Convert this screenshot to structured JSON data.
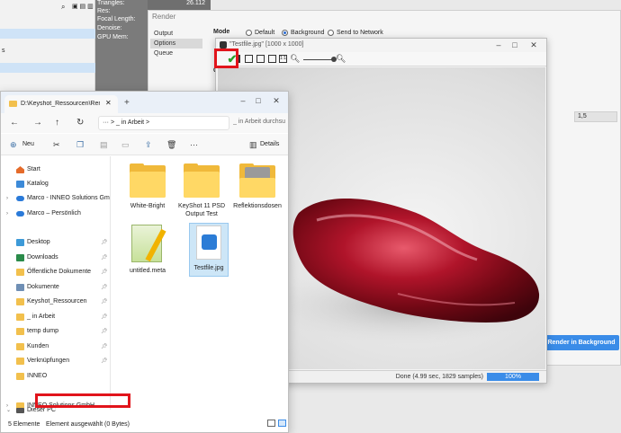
{
  "keyshot_bg": {
    "left_rows": [
      "",
      "",
      "s"
    ],
    "props": {
      "triangles_label": "Triangles:",
      "res_label": "Res:",
      "focal_label": "Focal Length:",
      "denoise_label": "Denoise:",
      "gpu_label": "GPU Mem:",
      "triangles_value": "26.112"
    }
  },
  "render_window": {
    "title": "Render",
    "side_items": [
      "Output",
      "Options",
      "Queue"
    ],
    "mode_label": "Mode",
    "modes": [
      "Default",
      "Background",
      "Send to Network"
    ],
    "selected_mode": "Background",
    "field_value": "1,5",
    "render_button": "Render in Background",
    "q_label": "Q"
  },
  "viewer": {
    "title": "\"Testfile.jpg\" [1000 x 1000]",
    "status": "Done (4.99 sec, 1829 samples)",
    "progress": "100%",
    "progress_value": 100,
    "highlight_color": "#e1141b"
  },
  "explorer": {
    "tab_title": "D:\\Keyshot_Ressourcen\\Rende",
    "address": "···  > _ in Arbeit  >",
    "search_placeholder": "_ in Arbeit durchsu",
    "new_label": "Neu",
    "details_label": "Details",
    "nav_items": [
      {
        "label": "Start",
        "icon": "home-icon"
      },
      {
        "label": "Katalog",
        "icon": "gallery-icon"
      },
      {
        "label": "Marco - INNEO Solutions GmbH",
        "icon": "cloud-icon"
      },
      {
        "label": "Marco – Persönlich",
        "icon": "cloud-icon"
      },
      {
        "label": "Desktop",
        "icon": "desktop-icon"
      },
      {
        "label": "Downloads",
        "icon": "download-icon"
      },
      {
        "label": "Öffentliche Dokumente",
        "icon": "folder-icon"
      },
      {
        "label": "Dokumente",
        "icon": "documents-icon"
      },
      {
        "label": "Keyshot_Ressourcen",
        "icon": "folder-icon"
      },
      {
        "label": "_ in Arbeit",
        "icon": "folder-icon"
      },
      {
        "label": "temp dump",
        "icon": "folder-icon"
      },
      {
        "label": "Kunden",
        "icon": "folder-icon"
      },
      {
        "label": "Verknüpfungen",
        "icon": "folder-icon"
      },
      {
        "label": "INNEO",
        "icon": "folder-icon"
      },
      {
        "label": "INNEO Solutions GmbH",
        "icon": "folder-icon"
      },
      {
        "label": "Dieser PC",
        "icon": "pc-icon"
      }
    ],
    "files": [
      {
        "name": "White-Bright",
        "type": "folder"
      },
      {
        "name": "KeyShot 11 PSD Output Test",
        "type": "folder"
      },
      {
        "name": "Reflektionsdosen",
        "type": "folder-image"
      },
      {
        "name": "untitled.meta",
        "type": "meta"
      },
      {
        "name": "Testfile.jpg",
        "type": "image",
        "selected": true
      }
    ],
    "count": "5 Elemente",
    "selected_text": "Element ausgewählt (0 Bytes)"
  }
}
